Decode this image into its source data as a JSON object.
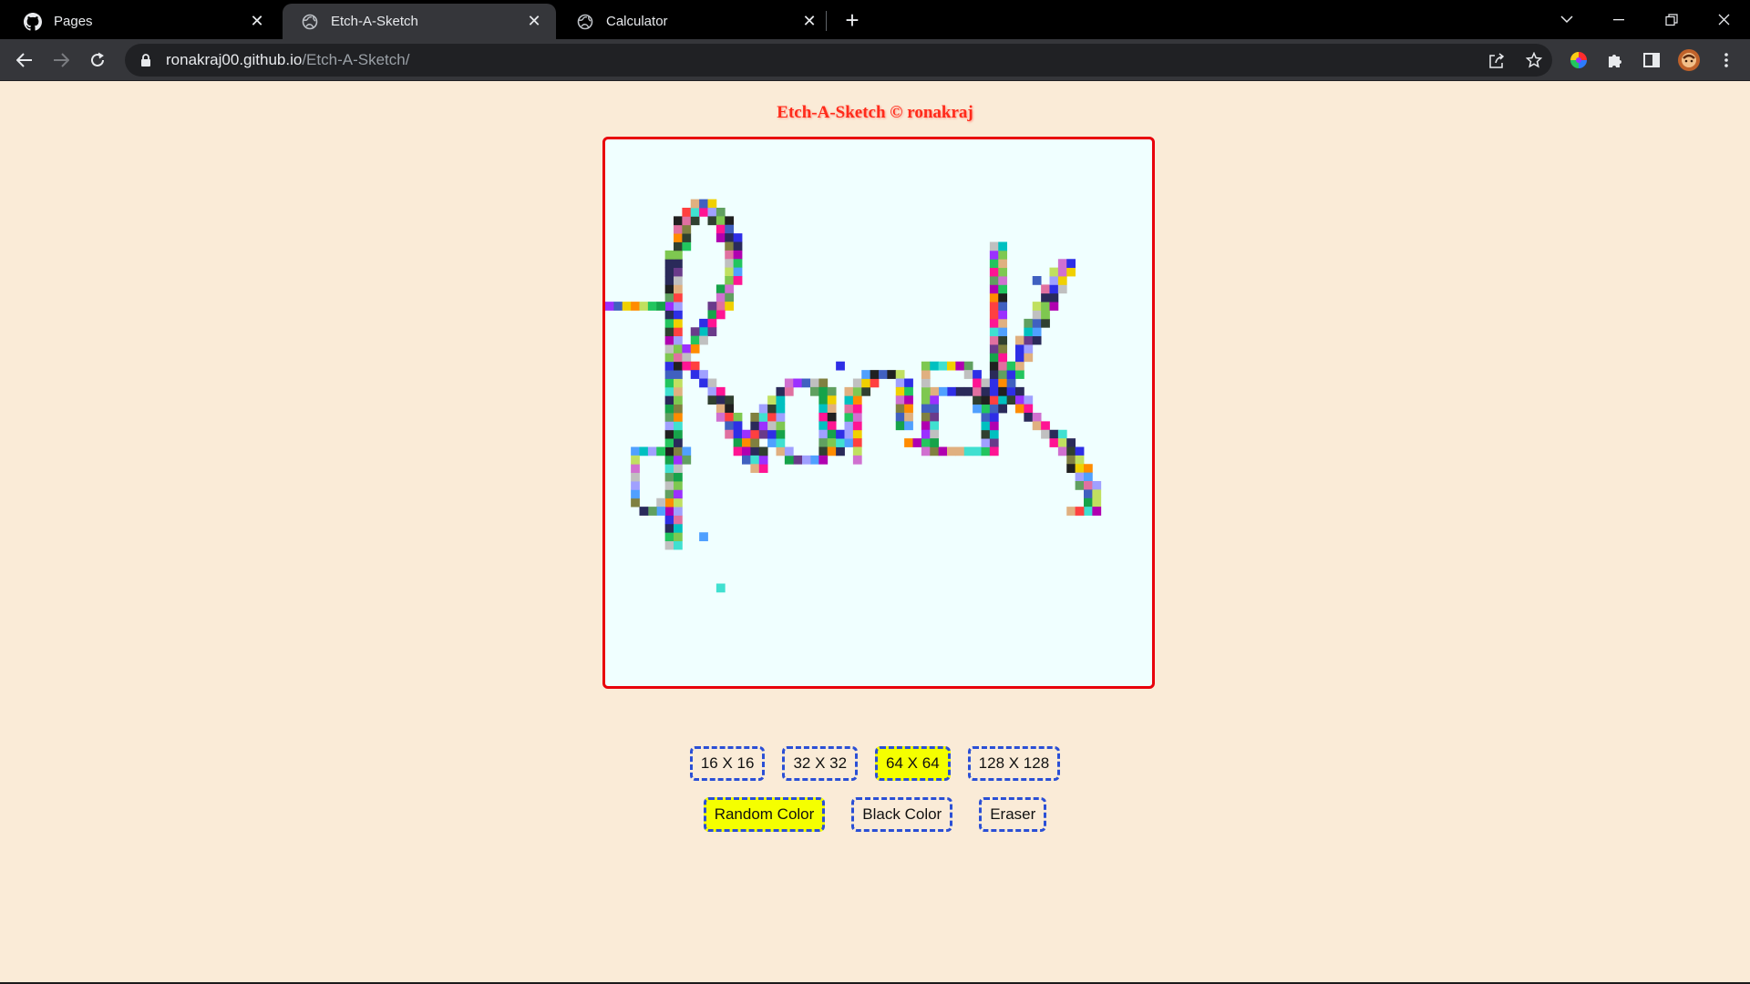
{
  "browser": {
    "tabs": [
      {
        "title": "Pages",
        "icon": "github-icon",
        "active": false
      },
      {
        "title": "Etch-A-Sketch",
        "icon": "globe-icon",
        "active": true
      },
      {
        "title": "Calculator",
        "icon": "globe-icon",
        "active": false
      }
    ],
    "url_host": "ronakraj00.github.io",
    "url_path": "/Etch-A-Sketch/"
  },
  "page": {
    "title": "Etch-A-Sketch © ronakraj",
    "grid_size_buttons": [
      {
        "label": "16 X 16",
        "selected": false
      },
      {
        "label": "32 X 32",
        "selected": false
      },
      {
        "label": "64 X 64",
        "selected": true
      },
      {
        "label": "128 X 128",
        "selected": false
      }
    ],
    "mode_buttons": [
      {
        "label": "Random Color",
        "selected": true
      },
      {
        "label": "Black Color",
        "selected": false
      },
      {
        "label": "Eraser",
        "selected": false
      }
    ],
    "grid_resolution": 64,
    "drawn_text": "Ronak",
    "colors": {
      "board_bg": "#f0ffff",
      "board_border": "#e8000b",
      "selected_btn": "#f5ff00",
      "btn_border": "#2a4fd6",
      "page_bg": "#faebd7"
    }
  }
}
